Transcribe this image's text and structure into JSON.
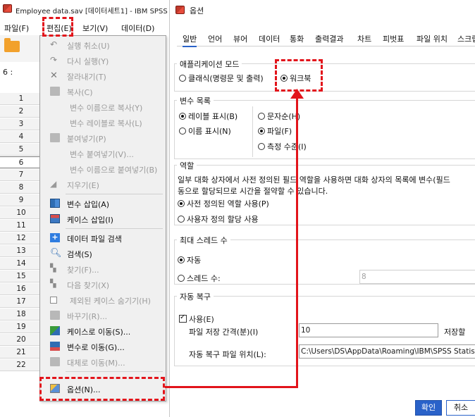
{
  "spss_window": {
    "title": "Employee data.sav [데이터세트1] - IBM SPSS",
    "menu": [
      "파일(F)",
      "편집(E)",
      "보기(V)",
      "데이터(D)"
    ],
    "cell_ref": "6 :",
    "rows": [
      "1",
      "2",
      "3",
      "4",
      "5",
      "6",
      "7",
      "8",
      "9",
      "10",
      "11",
      "12",
      "13",
      "14",
      "15",
      "16",
      "17",
      "18",
      "19",
      "20",
      "21",
      "22"
    ]
  },
  "edit_menu": {
    "items": [
      {
        "label": "실행 취소(U)",
        "enabled": false,
        "icon": "undo-icon"
      },
      {
        "label": "다시 실행(Y)",
        "enabled": false,
        "icon": "redo-icon"
      },
      {
        "label": "잘라내기(T)",
        "enabled": false,
        "icon": "cut-icon"
      },
      {
        "label": "복사(C)",
        "enabled": false,
        "icon": "copy-icon"
      },
      {
        "label": "변수 이름으로 복사(Y)",
        "enabled": false,
        "icon": ""
      },
      {
        "label": "변수 레이블로 복사(L)",
        "enabled": false,
        "icon": ""
      },
      {
        "label": "붙여넣기(P)",
        "enabled": false,
        "icon": "paste-icon"
      },
      {
        "label": "변수 붙여넣기(V)...",
        "enabled": false,
        "icon": ""
      },
      {
        "label": "변수 이름으로 붙여넣기(B)",
        "enabled": false,
        "icon": ""
      },
      {
        "label": "지우기(E)",
        "enabled": false,
        "icon": "eraser-icon"
      },
      {
        "label": "변수 삽입(A)",
        "enabled": true,
        "icon": "insert-variable-icon"
      },
      {
        "label": "케이스 삽입(I)",
        "enabled": true,
        "icon": "insert-case-icon"
      },
      {
        "label": "데이터 파일 검색",
        "enabled": true,
        "icon": "search-data-file-icon"
      },
      {
        "label": "검색(S)",
        "enabled": true,
        "icon": "search-icon"
      },
      {
        "label": "찾기(F)...",
        "enabled": false,
        "icon": "find-icon"
      },
      {
        "label": "다음 찾기(X)",
        "enabled": false,
        "icon": "find-next-icon"
      },
      {
        "label": "제외된 케이스 숨기기(H)",
        "enabled": false,
        "icon": "checkbox-icon"
      },
      {
        "label": "바꾸기(R)...",
        "enabled": false,
        "icon": "replace-icon"
      },
      {
        "label": "케이스로 이동(S)...",
        "enabled": true,
        "icon": "go-to-case-icon"
      },
      {
        "label": "변수로 이동(G)...",
        "enabled": true,
        "icon": "go-to-variable-icon"
      },
      {
        "label": "대체로 이동(M)...",
        "enabled": false,
        "icon": "go-to-imputation-icon"
      },
      {
        "label": "옵션(N)...",
        "enabled": true,
        "icon": "options-icon"
      }
    ]
  },
  "dialog": {
    "title": "옵션",
    "tabs": [
      "일반",
      "언어",
      "뷰어",
      "데이터",
      "통화",
      "출력결과",
      "차트",
      "피벗표",
      "파일 위치",
      "스크립"
    ],
    "active_tab": "일반",
    "app_mode": {
      "title": "애플리케이션 모드",
      "classic": "클래식(명령문 및 출력)",
      "workbook": "워크북"
    },
    "var_list": {
      "title": "변수 목록",
      "show_labels": "레이블 표시(B)",
      "show_names": "이름 표시(N)",
      "alphabetical": "문자순(H)",
      "file": "파일(F)",
      "measurement": "측정 수준(I)"
    },
    "roles": {
      "title": "역할",
      "desc1": "일부 대화 상자에서 사전 정의된 필드 역할을 사용하면 대화 상자의 목록에 변수(필드",
      "desc2": "동으로 할당되므로 시간을 절약할 수 있습니다.",
      "predefined": "사전 정의된 역할 사용(P)",
      "custom": "사용자 정의 할당 사용"
    },
    "threads": {
      "title": "최대 스레드 수",
      "auto": "자동",
      "count_label": "스레드 수:",
      "count_value": "8"
    },
    "autorecover": {
      "title": "자동 복구",
      "enable": "사용(E)",
      "interval_label": "파일 저장 간격(분)(I)",
      "interval_value": "10",
      "save_label": "저장할 ",
      "location_label": "자동 복구 파일 위치(L):",
      "location_value": "C:\\Users\\DS\\AppData\\Roaming\\IBM\\SPSS Statisti"
    },
    "ok": "확인",
    "cancel": "취소"
  }
}
